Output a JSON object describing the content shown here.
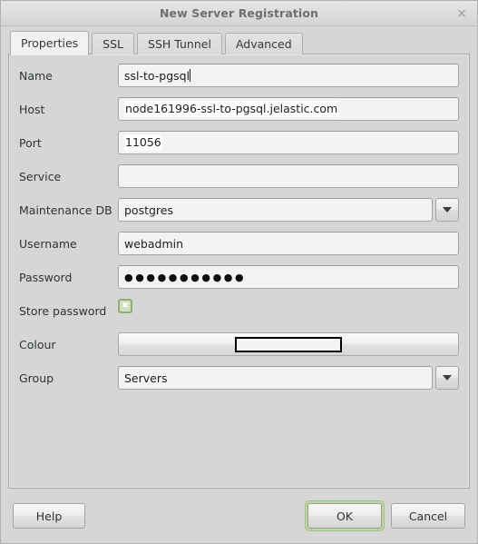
{
  "window": {
    "title": "New Server Registration",
    "close_icon": "close-icon",
    "close_glyph": "×"
  },
  "tabs": [
    {
      "label": "Properties",
      "active": true
    },
    {
      "label": "SSL",
      "active": false
    },
    {
      "label": "SSH Tunnel",
      "active": false
    },
    {
      "label": "Advanced",
      "active": false
    }
  ],
  "form": {
    "name": {
      "label": "Name",
      "value": "ssl-to-pgsql"
    },
    "host": {
      "label": "Host",
      "value": "node161996-ssl-to-pgsql.jelastic.com"
    },
    "port": {
      "label": "Port",
      "value": "11056"
    },
    "service": {
      "label": "Service",
      "value": ""
    },
    "maintenance": {
      "label": "Maintenance DB",
      "value": "postgres"
    },
    "username": {
      "label": "Username",
      "value": "webadmin"
    },
    "password": {
      "label": "Password",
      "value": "●●●●●●●●●●●"
    },
    "store_password": {
      "label": "Store password",
      "checked": true,
      "check_glyph": "✖"
    },
    "colour": {
      "label": "Colour",
      "swatch_colour": "#f4f4f3"
    },
    "group": {
      "label": "Group",
      "value": "Servers"
    }
  },
  "footer": {
    "help": "Help",
    "ok": "OK",
    "cancel": "Cancel"
  },
  "colors": {
    "dialog_bg": "#d6d6d6",
    "field_bg": "#f3f3f2",
    "focus_ring": "#bcd7a4",
    "checkbox_border": "#8cad72",
    "title_text": "#6f6f6f"
  }
}
